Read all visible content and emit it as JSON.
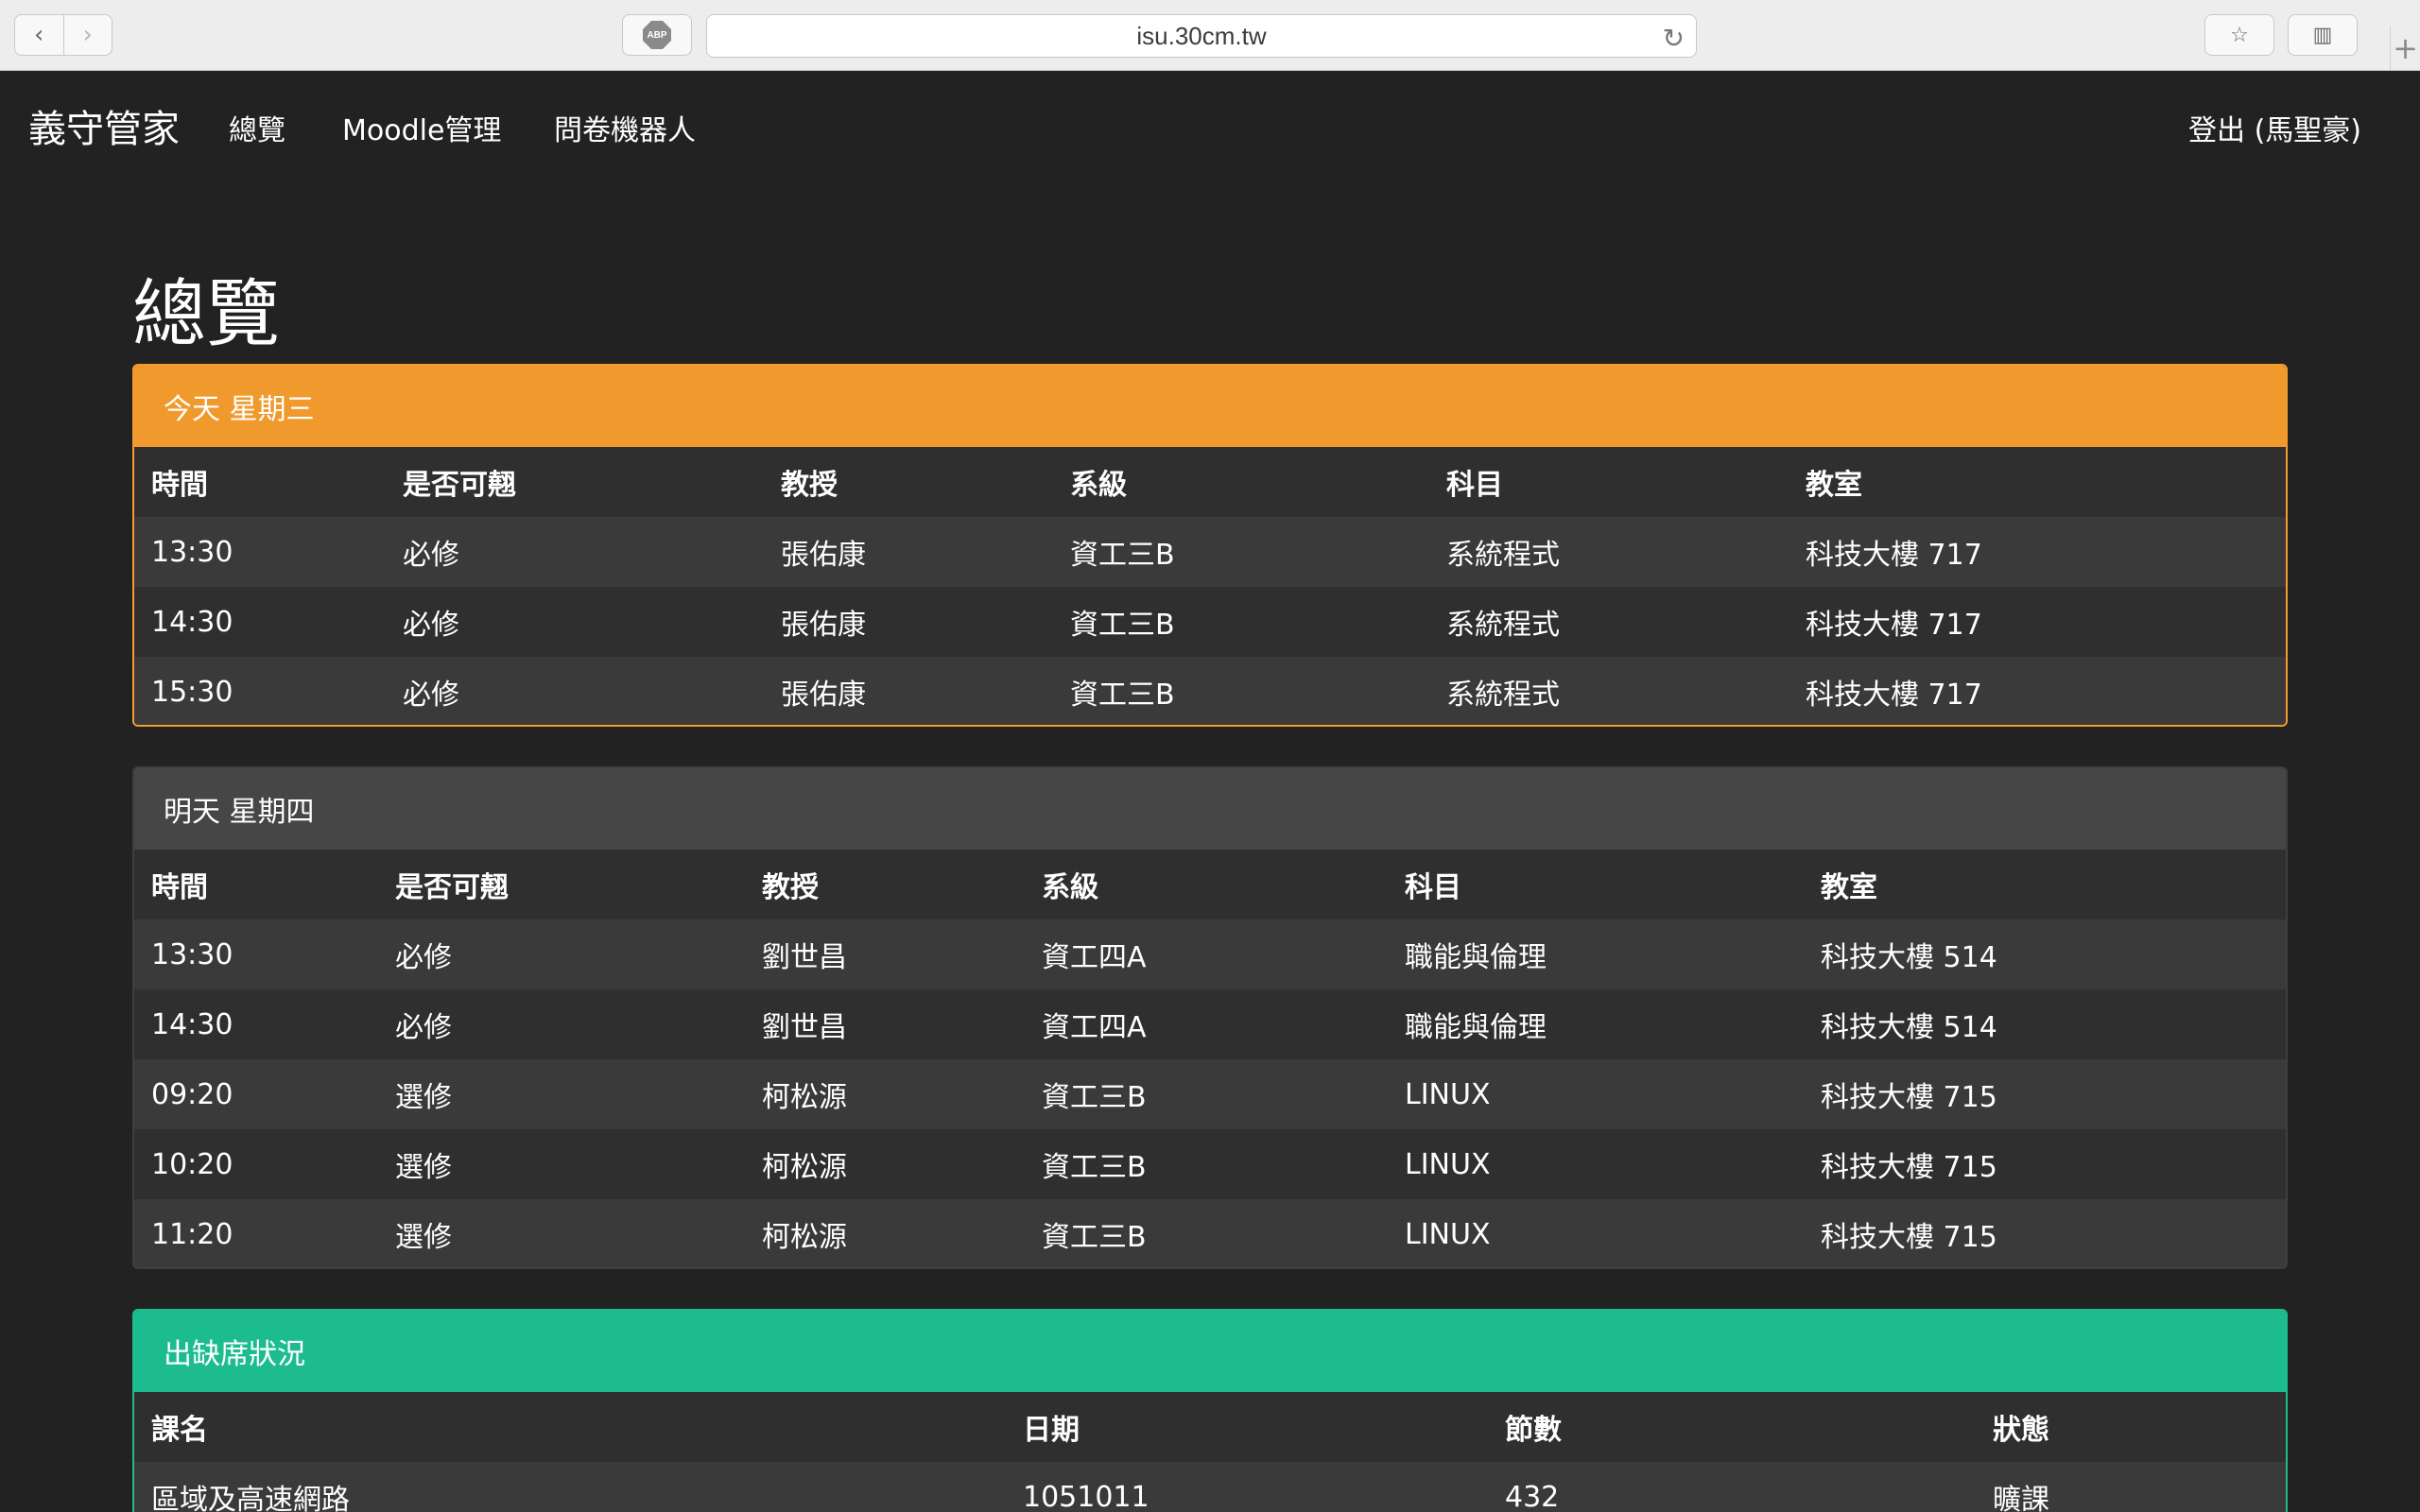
{
  "browser": {
    "url": "isu.30cm.tw",
    "abp_label": "ABP",
    "back_glyph": "‹",
    "forward_glyph": "›",
    "reload_glyph": "↻",
    "bookmark_glyph": "☆",
    "sidebar_glyph": "▥",
    "newtab_glyph": "+"
  },
  "nav": {
    "brand": "義守管家",
    "links": [
      "總覽",
      "Moodle管理",
      "問卷機器人"
    ],
    "logout": "登出 (馬聖豪)"
  },
  "page": {
    "title": "總覽"
  },
  "today": {
    "heading": "今天 星期三",
    "accent": "#f09a2d",
    "columns": [
      "時間",
      "是否可翹",
      "教授",
      "系級",
      "科目",
      "教室"
    ],
    "rows": [
      [
        "13:30",
        "必修",
        "張佑康",
        "資工三B",
        "系統程式",
        "科技大樓 717"
      ],
      [
        "14:30",
        "必修",
        "張佑康",
        "資工三B",
        "系統程式",
        "科技大樓 717"
      ],
      [
        "15:30",
        "必修",
        "張佑康",
        "資工三B",
        "系統程式",
        "科技大樓 717"
      ]
    ]
  },
  "tomorrow": {
    "heading": "明天 星期四",
    "accent": "#464646",
    "columns": [
      "時間",
      "是否可翹",
      "教授",
      "系級",
      "科目",
      "教室"
    ],
    "rows": [
      [
        "13:30",
        "必修",
        "劉世昌",
        "資工四A",
        "職能與倫理",
        "科技大樓 514"
      ],
      [
        "14:30",
        "必修",
        "劉世昌",
        "資工四A",
        "職能與倫理",
        "科技大樓 514"
      ],
      [
        "09:20",
        "選修",
        "柯松源",
        "資工三B",
        "LINUX",
        "科技大樓 715"
      ],
      [
        "10:20",
        "選修",
        "柯松源",
        "資工三B",
        "LINUX",
        "科技大樓 715"
      ],
      [
        "11:20",
        "選修",
        "柯松源",
        "資工三B",
        "LINUX",
        "科技大樓 715"
      ]
    ]
  },
  "attendance": {
    "heading": "出缺席狀況",
    "accent": "#1dbc8f",
    "columns": [
      "課名",
      "日期",
      "節數",
      "狀態"
    ],
    "rows": [
      [
        "區域及高速網路",
        "1051011",
        "432",
        "曠課"
      ]
    ]
  }
}
